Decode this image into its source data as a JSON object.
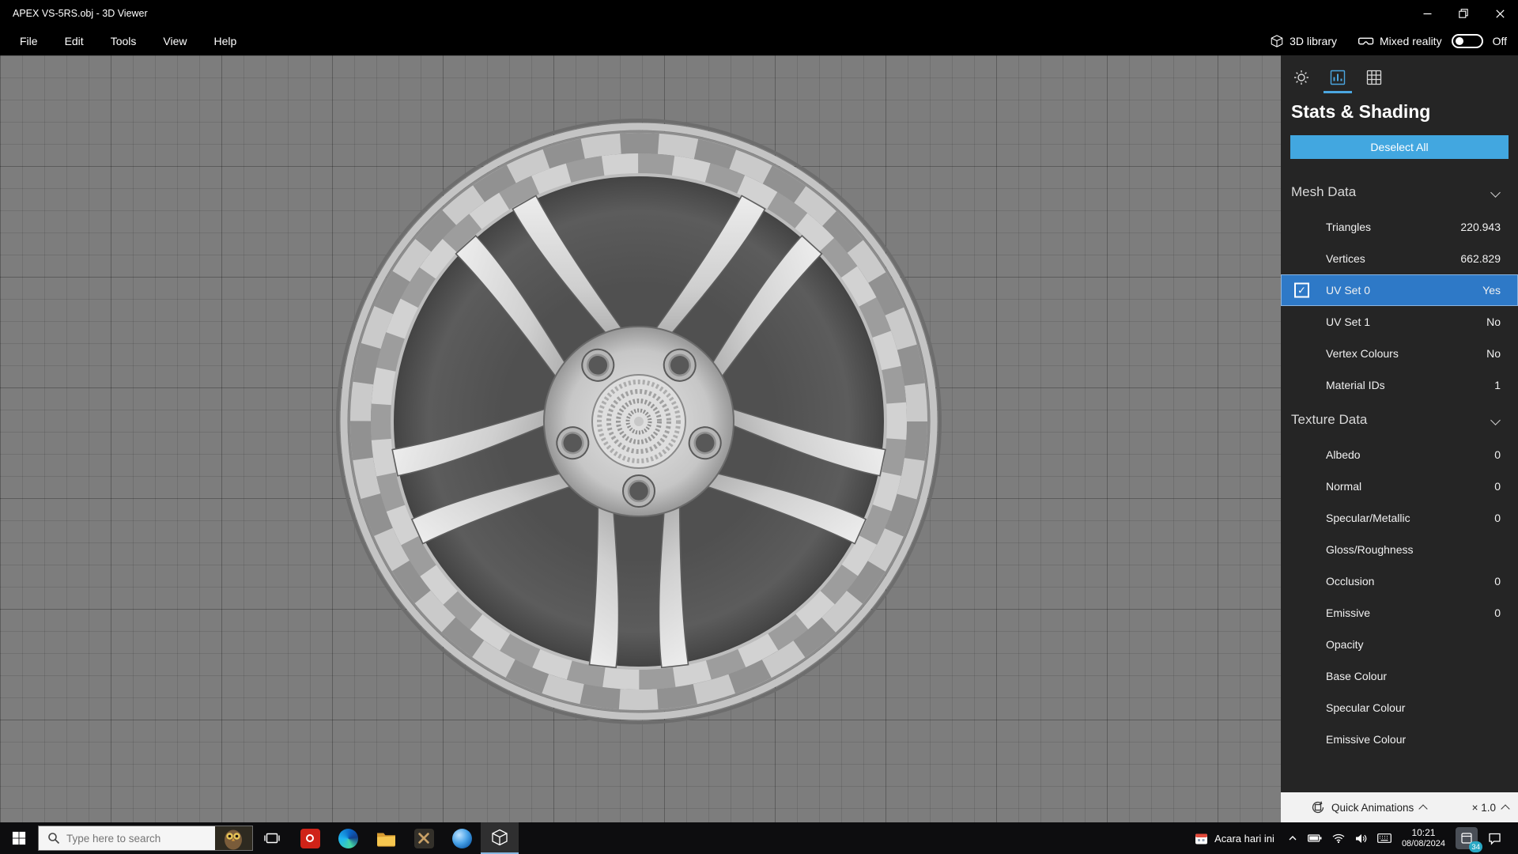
{
  "window": {
    "title": "APEX VS-5RS.obj - 3D Viewer"
  },
  "menubar": {
    "items": [
      "File",
      "Edit",
      "Tools",
      "View",
      "Help"
    ],
    "library_label": "3D library",
    "mixed_reality_label": "Mixed reality",
    "mixed_reality_state": "Off"
  },
  "panel": {
    "title": "Stats & Shading",
    "deselect_all_label": "Deselect All",
    "checkbox_glyph": "✓",
    "mesh": {
      "title": "Mesh Data",
      "rows": [
        {
          "label": "Triangles",
          "value": "220.943"
        },
        {
          "label": "Vertices",
          "value": "662.829"
        },
        {
          "label": "UV Set 0",
          "value": "Yes",
          "selected": true
        },
        {
          "label": "UV Set 1",
          "value": "No"
        },
        {
          "label": "Vertex Colours",
          "value": "No"
        },
        {
          "label": "Material IDs",
          "value": "1"
        }
      ]
    },
    "texture": {
      "title": "Texture Data",
      "rows": [
        {
          "label": "Albedo",
          "value": "0"
        },
        {
          "label": "Normal",
          "value": "0"
        },
        {
          "label": "Specular/Metallic",
          "value": "0"
        },
        {
          "label": "Gloss/Roughness",
          "value": ""
        },
        {
          "label": "Occlusion",
          "value": "0"
        },
        {
          "label": "Emissive",
          "value": "0"
        },
        {
          "label": "Opacity",
          "value": ""
        },
        {
          "label": "Base Colour",
          "value": ""
        },
        {
          "label": "Specular Colour",
          "value": ""
        },
        {
          "label": "Emissive Colour",
          "value": ""
        }
      ]
    }
  },
  "animation_bar": {
    "quick_animations_label": "Quick Animations",
    "speed_label": "× 1.0"
  },
  "taskbar": {
    "search_placeholder": "Type here to search",
    "tray": {
      "widget_label": "Acara hari ini",
      "time": "10:21",
      "date": "08/08/2024",
      "notification_badge": "34"
    }
  },
  "colors": {
    "accent": "#42a7e0",
    "selected_row": "#2e79c7",
    "viewport_background": "#7d7d7d",
    "panel_background": "#252525"
  }
}
